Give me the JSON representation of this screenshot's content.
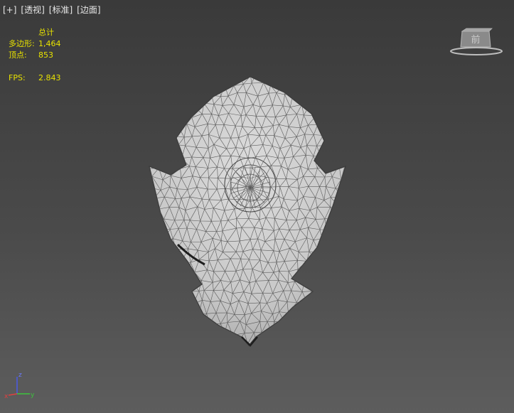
{
  "viewport_menu": {
    "items": [
      "[+]",
      "[透视]",
      "[标准]",
      "[边面]"
    ]
  },
  "stats": {
    "header": "总计",
    "polygons_label": "多边形:",
    "polygons_value": "1,464",
    "vertices_label": "顶点:",
    "vertices_value": "853",
    "fps_label": "FPS:",
    "fps_value": "2.843"
  },
  "viewcube": {
    "label": "前"
  },
  "axis_gizmo": {
    "z": "z",
    "y": "y",
    "x": "x",
    "colors": {
      "x": "#e04040",
      "y": "#3cc43c",
      "z": "#4a5ae8"
    }
  },
  "mesh": {
    "fill": "#d2d2d2",
    "wire": "#5a5a5a",
    "shade": "#9a9a9a"
  }
}
